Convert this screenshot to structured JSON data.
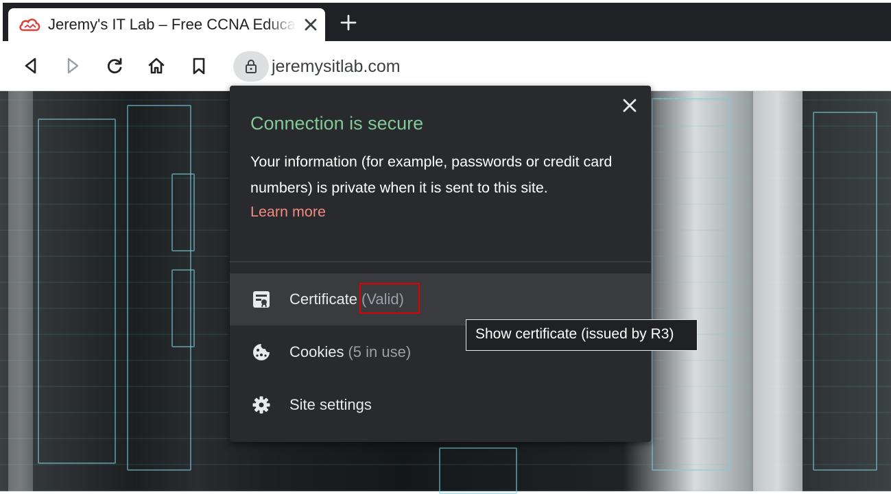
{
  "browser": {
    "tab": {
      "title": "Jeremy's IT Lab – Free CCNA Education",
      "favicon": "cloud-icon",
      "close_icon": "close-icon"
    },
    "new_tab_icon": "plus-icon",
    "toolbar": {
      "back_icon": "back-icon",
      "forward_icon": "forward-icon",
      "reload_icon": "reload-icon",
      "home_icon": "home-icon",
      "bookmark_icon": "bookmark-icon"
    },
    "omnibox": {
      "lock_icon": "lock-icon",
      "url": "jeremysitlab.com"
    }
  },
  "security_popup": {
    "title": "Connection is secure",
    "description": "Your information (for example, passwords or credit card numbers) is private when it is sent to this site.",
    "learn_more": "Learn more",
    "rows": [
      {
        "label": "Certificate",
        "sub": "(Valid)",
        "icon": "certificate-icon"
      },
      {
        "label": "Cookies",
        "sub": "(5 in use)",
        "icon": "cookie-icon"
      },
      {
        "label": "Site settings",
        "sub": "",
        "icon": "gear-icon"
      }
    ],
    "tooltip": "Show certificate (issued by R3)"
  },
  "colors": {
    "tabstrip": "#202124",
    "popup_bg": "#292a2d",
    "secure_green": "#81c995",
    "learn_more_red": "#f28b82",
    "annotation_red": "#e00000"
  }
}
